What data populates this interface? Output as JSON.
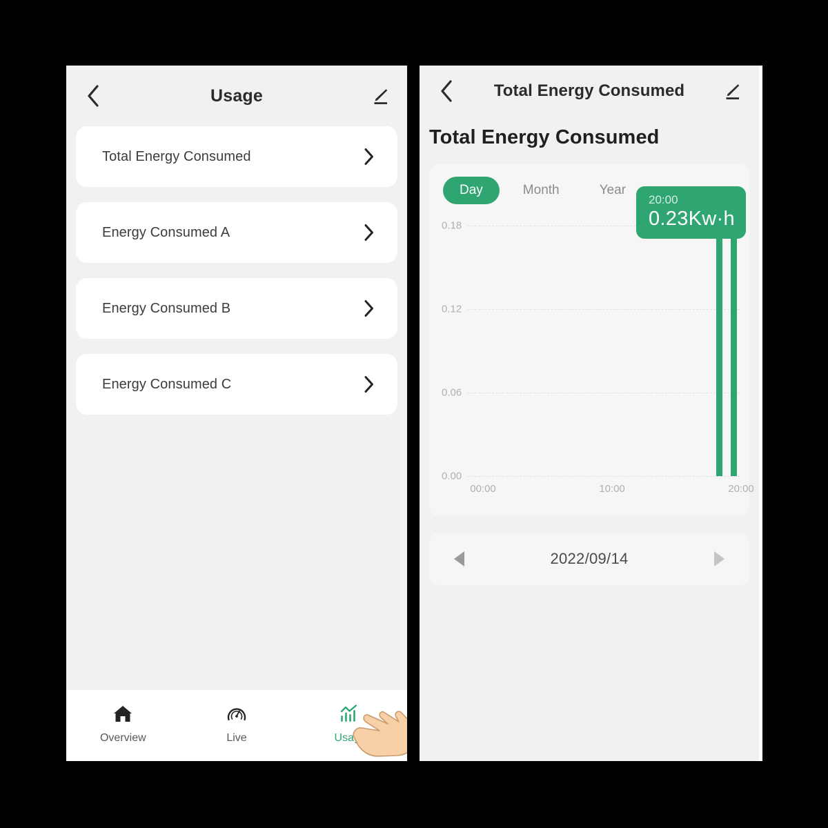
{
  "left_panel": {
    "header": {
      "back_icon": "chevron-left-icon",
      "title": "Usage",
      "edit_icon": "pencil-edit-icon"
    },
    "list": [
      {
        "label": "Total Energy Consumed",
        "chevron": "chevron-right-icon"
      },
      {
        "label": "Energy Consumed A",
        "chevron": "chevron-right-icon"
      },
      {
        "label": "Energy Consumed B",
        "chevron": "chevron-right-icon"
      },
      {
        "label": "Energy Consumed C",
        "chevron": "chevron-right-icon"
      }
    ],
    "bottom_nav": [
      {
        "label": "Overview",
        "icon": "home-icon",
        "active": false
      },
      {
        "label": "Live",
        "icon": "gauge-icon",
        "active": false
      },
      {
        "label": "Usage",
        "icon": "bar-chart-icon",
        "active": true
      }
    ],
    "cursor": "pointing-hand-cursor"
  },
  "right_panel": {
    "header": {
      "back_icon": "chevron-left-icon",
      "title": "Total Energy Consumed",
      "edit_icon": "pencil-edit-icon"
    },
    "page_title": "Total Energy Consumed",
    "range_tabs": [
      {
        "label": "Day",
        "active": true
      },
      {
        "label": "Month",
        "active": false
      },
      {
        "label": "Year",
        "active": false
      }
    ],
    "tooltip": {
      "time": "20:00",
      "value": "0.23Kw·h"
    },
    "date_nav": {
      "prev_icon": "triangle-left-icon",
      "date": "2022/09/14",
      "next_icon": "triangle-right-icon"
    }
  },
  "colors": {
    "accent_green": "#2fa572",
    "panel_background": "#f1f1f1",
    "card_background": "#ffffff",
    "chart_card_background": "#f6f6f6",
    "text_primary": "#2b2b2b",
    "text_muted": "#b0b0b0"
  },
  "chart_data": {
    "type": "bar",
    "title": "Total Energy Consumed",
    "xlabel": "",
    "ylabel": "",
    "unit": "Kw·h",
    "grid": true,
    "legend": "none",
    "ylim": [
      0,
      0.21
    ],
    "ytick_labels": [
      "0.00",
      "0.06",
      "0.12",
      "0.18"
    ],
    "ytick_values": [
      0.0,
      0.06,
      0.12,
      0.18
    ],
    "xlim": [
      "00:00",
      "24:00"
    ],
    "xtick_labels": [
      "00:00",
      "10:00",
      "20:00"
    ],
    "xtick_values": [
      0,
      10,
      20
    ],
    "categories": [
      "19:00",
      "20:00"
    ],
    "values": [
      0.21,
      0.23
    ],
    "highlighted_category": "20:00",
    "highlighted_value": 0.23
  }
}
